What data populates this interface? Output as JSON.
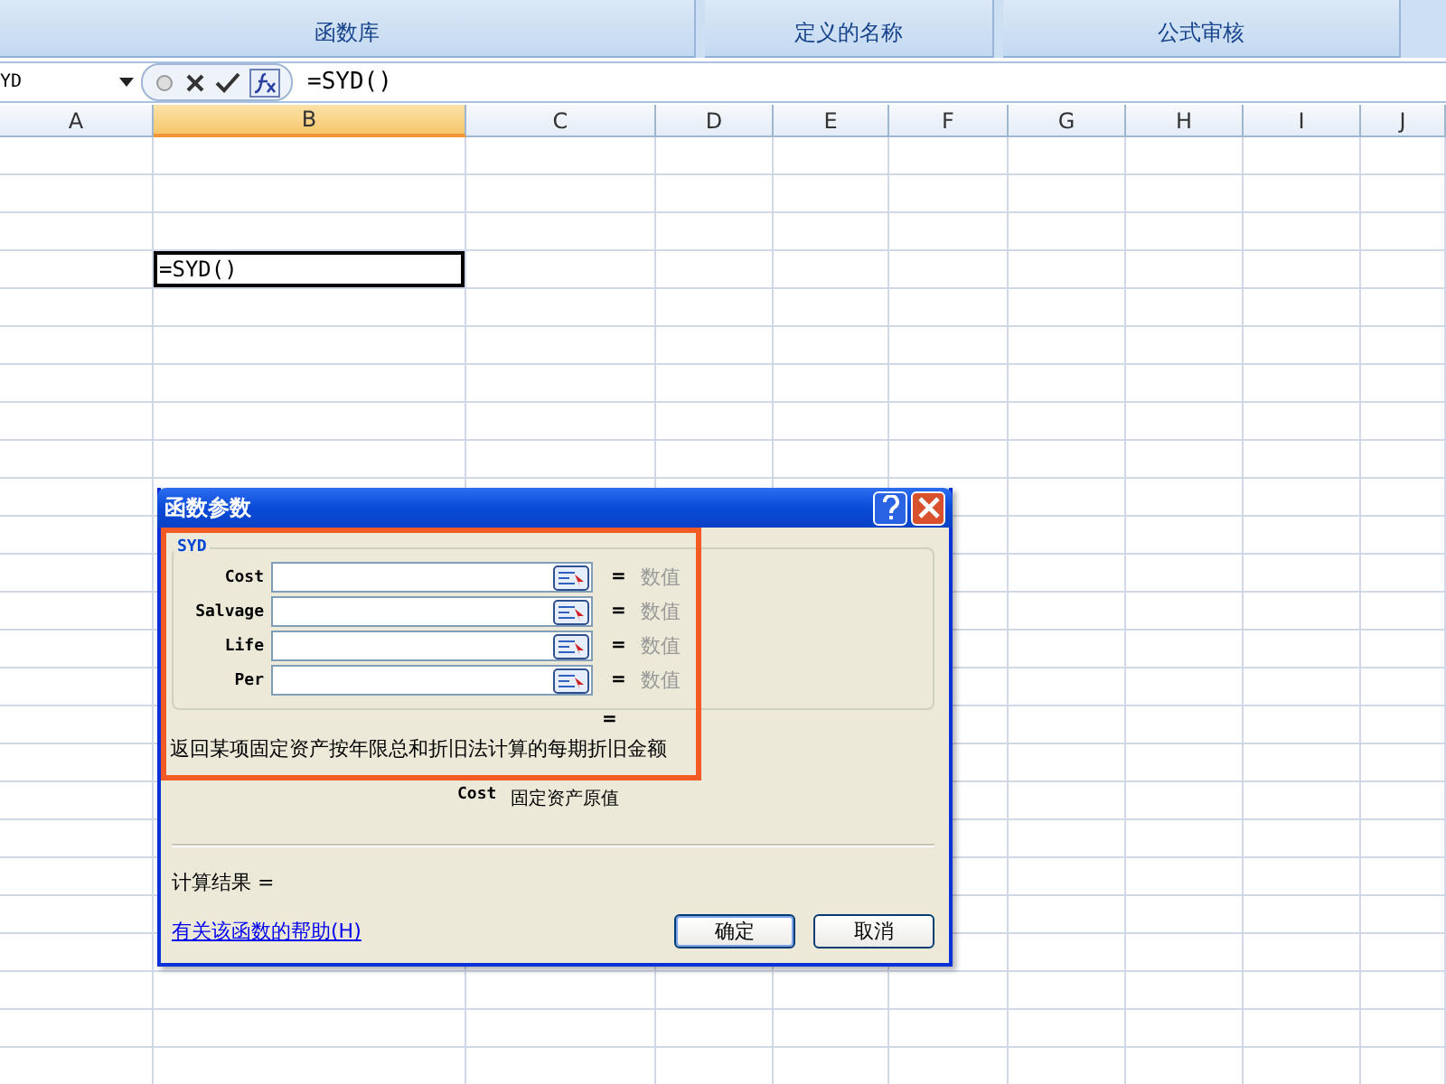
{
  "ribbon": {
    "groups": [
      {
        "label": "函数库"
      },
      {
        "label": "定义的名称"
      },
      {
        "label": "公式审核"
      }
    ]
  },
  "formula_bar": {
    "name_box": "YD",
    "formula": "=SYD()"
  },
  "columns": [
    {
      "label": "A",
      "selected": false
    },
    {
      "label": "B",
      "selected": true
    },
    {
      "label": "C",
      "selected": false
    },
    {
      "label": "D",
      "selected": false
    },
    {
      "label": "E",
      "selected": false
    },
    {
      "label": "F",
      "selected": false
    },
    {
      "label": "G",
      "selected": false
    },
    {
      "label": "H",
      "selected": false
    },
    {
      "label": "I",
      "selected": false
    },
    {
      "label": "J",
      "selected": false
    }
  ],
  "active_cell": {
    "value": "=SYD()"
  },
  "dialog": {
    "title": "函数参数",
    "function_name": "SYD",
    "arguments": [
      {
        "label": "Cost",
        "equals": "=",
        "hint": "数值"
      },
      {
        "label": "Salvage",
        "equals": "=",
        "hint": "数值"
      },
      {
        "label": "Life",
        "equals": "=",
        "hint": "数值"
      },
      {
        "label": "Per",
        "equals": "=",
        "hint": "数值"
      }
    ],
    "result_equals": "=",
    "description": "返回某项固定资产按年限总和折旧法计算的每期折旧金额",
    "argument_help": {
      "name": "Cost",
      "text": "固定资产原值"
    },
    "formula_result": "计算结果 =",
    "help_link": "有关该函数的帮助(H)",
    "buttons": [
      "确定",
      "取消"
    ]
  }
}
